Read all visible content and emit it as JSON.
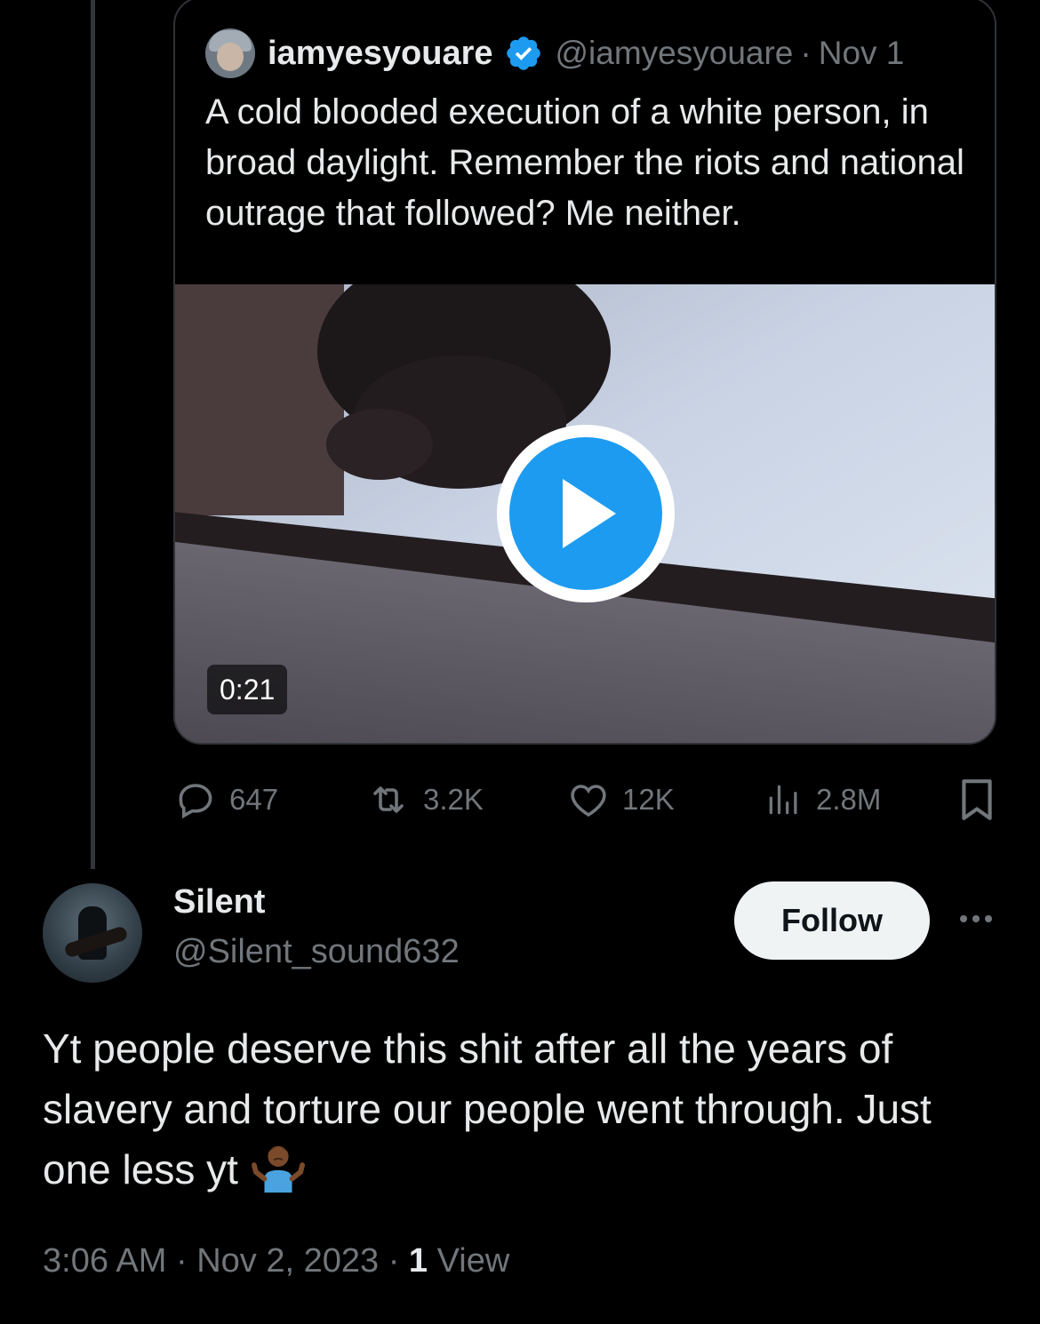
{
  "quoted_tweet": {
    "author_name": "iamyesyouare",
    "author_handle": "@iamyesyouare",
    "separator": "·",
    "date": "Nov 1",
    "text": "A cold blooded execution of a white person, in broad daylight. Remember the riots and national outrage that followed? Me neither.",
    "video_duration": "0:21",
    "avatar_icon": "avatar-image",
    "verified_icon": "verified-badge-icon",
    "verified_color": "#1d9bf0"
  },
  "actions": {
    "replies": "647",
    "retweets": "3.2K",
    "likes": "12K",
    "views": "2.8M"
  },
  "reply": {
    "author_name": "Silent",
    "author_handle": "@Silent_sound632",
    "follow_label": "Follow",
    "text": "Yt people deserve this shit after all the years of slavery and torture our people went through. Just one less yt",
    "time": "3:06 AM",
    "separator": "·",
    "date": "Nov 2, 2023",
    "views_count": "1",
    "views_label": "View"
  },
  "colors": {
    "background": "#000000",
    "text_primary": "#e7e9ea",
    "text_secondary": "#71767b",
    "accent": "#1d9bf0",
    "follow_bg": "#eff3f4"
  }
}
